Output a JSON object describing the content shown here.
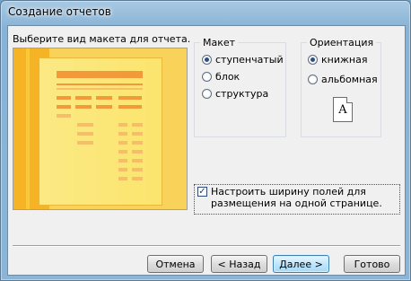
{
  "window": {
    "title": "Создание отчетов"
  },
  "instruction": "Выберите вид макета для отчета.",
  "layout_group": {
    "title": "Макет",
    "options": [
      {
        "label": "ступенчатый",
        "selected": true
      },
      {
        "label": "блок",
        "selected": false
      },
      {
        "label": "структура",
        "selected": false
      }
    ]
  },
  "orientation_group": {
    "title": "Ориентация",
    "options": [
      {
        "label": "книжная",
        "selected": true
      },
      {
        "label": "альбомная",
        "selected": false
      }
    ],
    "page_icon_letter": "A"
  },
  "fit_checkbox": {
    "checked": true,
    "label": "Настроить ширину полей для размещения на одной странице."
  },
  "buttons": {
    "cancel": "Отмена",
    "back": "< Назад",
    "next": "Далее >",
    "finish": "Готово"
  },
  "colors": {
    "preview_background": "#f2a21b",
    "preview_paper": "#fbe56e",
    "preview_bars": "#f29a3a"
  }
}
